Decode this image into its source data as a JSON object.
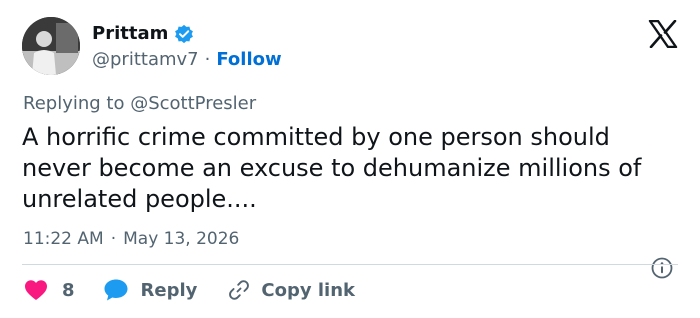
{
  "author": {
    "display_name": "Prittam",
    "handle": "@prittamv7",
    "separator": "·",
    "follow_label": "Follow",
    "verified_color": "#1d9bf0"
  },
  "reply_context": {
    "prefix": "Replying to",
    "mention": "@ScottPresler"
  },
  "tweet": {
    "text": "A horrific crime committed by one person should never become an excuse to dehumanize millions of unrelated people....",
    "time": "11:22 AM",
    "separator": "·",
    "date": "May 13, 2026"
  },
  "actions": {
    "like_count": "8",
    "reply_label": "Reply",
    "copy_label": "Copy link"
  },
  "colors": {
    "like": "#f91880",
    "reply": "#1d9bf0",
    "follow": "#006fd6",
    "muted": "#536471",
    "text": "#0f1419"
  },
  "icons": {
    "brand": "x-logo-icon",
    "verified": "verified-badge-icon",
    "info": "info-icon",
    "like": "heart-icon",
    "reply": "speech-bubble-icon",
    "copy": "link-icon"
  }
}
